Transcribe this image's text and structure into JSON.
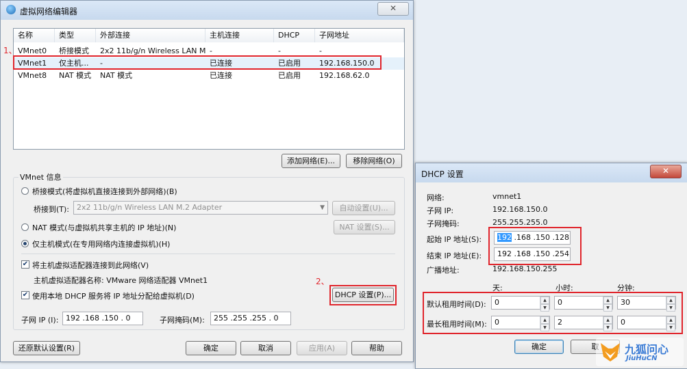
{
  "main_window": {
    "title": "虚拟网络编辑器",
    "columns": [
      "名称",
      "类型",
      "外部连接",
      "主机连接",
      "DHCP",
      "子网地址"
    ],
    "rows": [
      [
        "VMnet0",
        "桥接模式",
        "2x2 11b/g/n Wireless LAN M...",
        "-",
        "-",
        "-"
      ],
      [
        "VMnet1",
        "仅主机...",
        "-",
        "已连接",
        "已启用",
        "192.168.150.0"
      ],
      [
        "VMnet8",
        "NAT 模式",
        "NAT 模式",
        "已连接",
        "已启用",
        "192.168.62.0"
      ]
    ],
    "add_network": "添加网络(E)...",
    "remove_network": "移除网络(O)",
    "vmnet_info": "VMnet 信息",
    "bridge_mode": "桥接模式(将虚拟机直接连接到外部网络)(B)",
    "bridge_to_label": "桥接到(T):",
    "bridge_to_value": "2x2 11b/g/n Wireless LAN M.2 Adapter",
    "auto_settings": "自动设置(U)...",
    "nat_mode": "NAT 模式(与虚拟机共享主机的 IP 地址)(N)",
    "nat_settings": "NAT 设置(S)...",
    "host_only_mode": "仅主机模式(在专用网络内连接虚拟机)(H)",
    "connect_adapter": "将主机虚拟适配器连接到此网络(V)",
    "adapter_name": "主机虚拟适配器名称: VMware 网络适配器 VMnet1",
    "use_dhcp": "使用本地 DHCP 服务将 IP 地址分配给虚拟机(D)",
    "dhcp_settings": "DHCP 设置(P)...",
    "subnet_ip_label": "子网 IP (I):",
    "subnet_ip_value": "192 .168 .150 . 0",
    "subnet_mask_label": "子网掩码(M):",
    "subnet_mask_value": "255 .255 .255 . 0",
    "restore_defaults": "还原默认设置(R)",
    "ok": "确定",
    "cancel": "取消",
    "apply": "应用(A)",
    "help": "帮助"
  },
  "annotations": {
    "step1": "1、",
    "step2": "2、"
  },
  "dhcp_window": {
    "title": "DHCP 设置",
    "network_label": "网络:",
    "network_value": "vmnet1",
    "subnet_ip_label": "子网 IP:",
    "subnet_ip_value": "192.168.150.0",
    "subnet_mask_label": "子网掩码:",
    "subnet_mask_value": "255.255.255.0",
    "start_ip_label": "起始 IP 地址(S):",
    "start_ip_first": "192",
    "start_ip_rest": " .168 .150 .128",
    "end_ip_label": "结束 IP 地址(E):",
    "end_ip_value": "192 .168 .150 .254",
    "broadcast_label": "广播地址:",
    "broadcast_value": "192.168.150.255",
    "days": "天:",
    "hours": "小时:",
    "minutes": "分钟:",
    "default_lease_label": "默认租用时间(D):",
    "default_lease": [
      "0",
      "0",
      "30"
    ],
    "max_lease_label": "最长租用时间(M):",
    "max_lease": [
      "0",
      "2",
      "0"
    ],
    "ok": "确定",
    "cancel": "取"
  },
  "watermark": {
    "brand": "九狐问心",
    "sub": "JiuHuCN"
  },
  "colors": {
    "highlight": "#e0242b",
    "selection": "#3399ff"
  }
}
